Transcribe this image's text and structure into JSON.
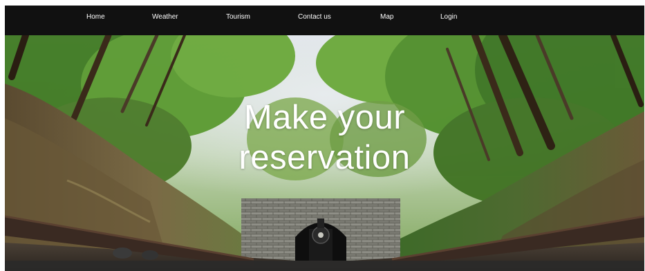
{
  "nav": {
    "items": [
      {
        "label": "Home"
      },
      {
        "label": "Weather"
      },
      {
        "label": "Tourism"
      },
      {
        "label": "Contact us"
      },
      {
        "label": "Map"
      },
      {
        "label": "Login"
      }
    ]
  },
  "hero": {
    "title_line1": "Make your",
    "title_line2": "reservation"
  },
  "colors": {
    "navbar_bg": "#111111",
    "nav_text": "#ffffff",
    "hero_text": "#ffffff",
    "foliage": "#4f8a2c",
    "tunnel_stone": "#8a8a82"
  }
}
